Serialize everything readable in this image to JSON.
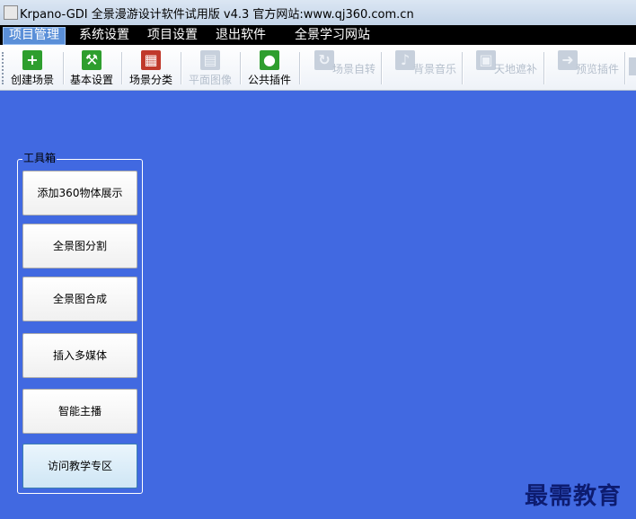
{
  "window": {
    "title": "Krpano-GDI 全景漫游设计软件试用版 v4.3  官方网站:www.qj360.com.cn"
  },
  "menu": {
    "items": [
      "项目管理",
      "系统设置",
      "项目设置",
      "退出软件",
      "全景学习网站"
    ]
  },
  "toolbar": {
    "buttons": [
      {
        "label": "创建场景",
        "icon": "plus-icon",
        "color": "#2e9e2e",
        "enabled": true
      },
      {
        "label": "基本设置",
        "icon": "hammer-icon",
        "color": "#2e9e2e",
        "enabled": true
      },
      {
        "label": "场景分类",
        "icon": "grid-icon",
        "color": "#c0392b",
        "enabled": true
      },
      {
        "label": "平面图像",
        "icon": "map-icon",
        "color": "#9aa5b5",
        "enabled": false
      },
      {
        "label": "公共插件",
        "icon": "user-icon",
        "color": "#2e9e2e",
        "enabled": true
      },
      {
        "label": "场景自转",
        "icon": "refresh-icon",
        "color": "#9aa5b5",
        "enabled": false
      },
      {
        "label": "背景音乐",
        "icon": "bell-icon",
        "color": "#9aa5b5",
        "enabled": false
      },
      {
        "label": "天地遮补",
        "icon": "lock-icon",
        "color": "#9aa5b5",
        "enabled": false
      },
      {
        "label": "预览插件",
        "icon": "arrow-icon",
        "color": "#9aa5b5",
        "enabled": false
      }
    ]
  },
  "toolbox": {
    "title": "工具箱",
    "buttons": [
      "添加360物体展示",
      "全景图分割",
      "全景图合成",
      "插入多媒体",
      "智能主播",
      "访问教学专区"
    ]
  },
  "watermark": "最需教育"
}
